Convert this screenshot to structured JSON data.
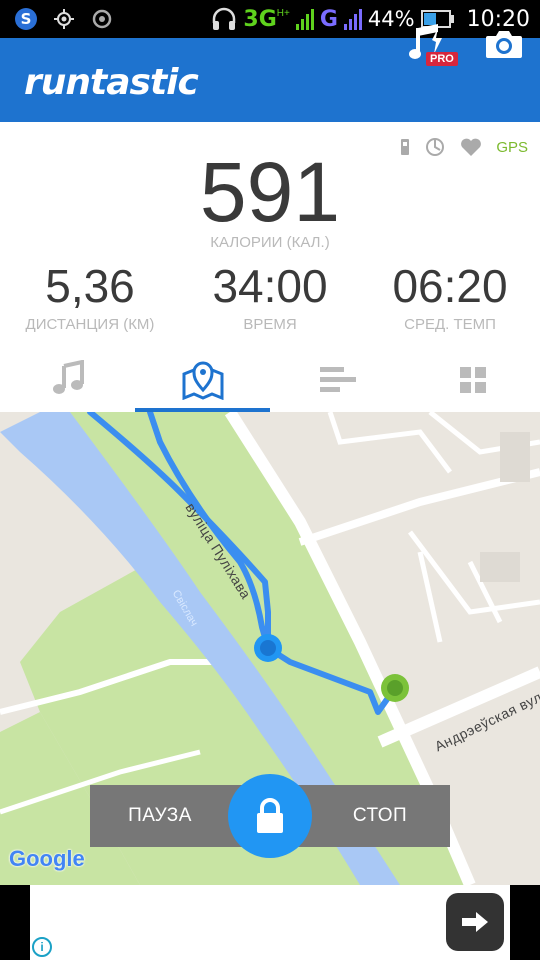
{
  "status_bar": {
    "network": "3G",
    "network_sub": "H+",
    "network2": "G",
    "battery": "44%",
    "time": "10:20",
    "icons": [
      "s-app-icon",
      "gps-icon",
      "record-icon",
      "headphones-icon",
      "signal-icon",
      "battery-icon"
    ]
  },
  "app_bar": {
    "logo": "runtastic",
    "pro_badge": "PRO",
    "icons": [
      "music-pro-icon",
      "camera-icon"
    ]
  },
  "sensors": {
    "gps": "GPS",
    "icons": [
      "phone-sensor-icon",
      "sync-icon",
      "heart-icon"
    ]
  },
  "stats": {
    "calories": {
      "value": "591",
      "label": "КАЛОРИИ (КАЛ.)"
    },
    "distance": {
      "value": "5,36",
      "label": "ДИСТАНЦИЯ (КМ)"
    },
    "time": {
      "value": "34:00",
      "label": "ВРЕМЯ"
    },
    "pace": {
      "value": "06:20",
      "label": "СРЕД. ТЕМП"
    }
  },
  "tabs": [
    {
      "icon": "music-note-icon",
      "active": false
    },
    {
      "icon": "map-pin-icon",
      "active": true
    },
    {
      "icon": "list-bars-icon",
      "active": false
    },
    {
      "icon": "grid-icon",
      "active": false
    }
  ],
  "map": {
    "street_1": "вуліца Пуліхава",
    "street_2": "Андрэеўская вул",
    "river": "Свіслач",
    "attribution": "Google",
    "colors": {
      "water": "#a9c8f5",
      "park": "#c8e4a3",
      "route": "#3b8ef0",
      "start": "#2196f3",
      "end": "#7cc23a"
    }
  },
  "controls": {
    "pause": "ПАУЗА",
    "stop": "СТОП",
    "lock_icon": "lock-icon"
  },
  "ad": {
    "icons": [
      "arrow-right-icon",
      "info-icon"
    ]
  },
  "colors": {
    "brand": "#1e73cf",
    "gps": "#7cba2f",
    "accent": "#2196f3"
  }
}
